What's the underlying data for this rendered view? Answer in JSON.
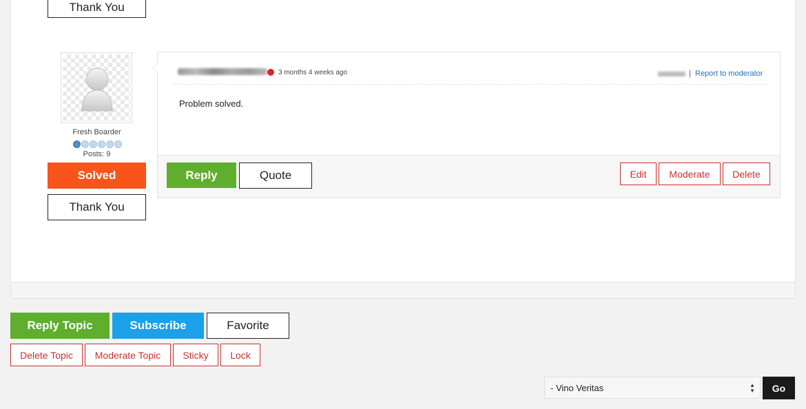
{
  "previous_post": {
    "thank_you_label": "Thank You"
  },
  "author": {
    "rank": "Fresh Boarder",
    "rank_level": 1,
    "rank_max": 6,
    "posts": "Posts: 9",
    "solved_label": "Solved",
    "thank_you_label": "Thank You"
  },
  "post": {
    "time": "3 months 4 weeks ago",
    "separator": "|",
    "report_label": "Report to moderator",
    "body": "Problem solved.",
    "status_color": "#d9232d"
  },
  "post_actions": {
    "reply_label": "Reply",
    "quote_label": "Quote",
    "edit_label": "Edit",
    "moderate_label": "Moderate",
    "delete_label": "Delete"
  },
  "topic_actions": {
    "reply_topic_label": "Reply Topic",
    "subscribe_label": "Subscribe",
    "favorite_label": "Favorite",
    "delete_topic_label": "Delete Topic",
    "moderate_topic_label": "Moderate Topic",
    "sticky_label": "Sticky",
    "lock_label": "Lock"
  },
  "forum_jump": {
    "selected": "- Vino Veritas",
    "go_label": "Go"
  },
  "colors": {
    "green": "#5fae2d",
    "blue": "#1ca0e8",
    "orange": "#f9541a",
    "red": "#c9302c",
    "link": "#2a6db5"
  }
}
